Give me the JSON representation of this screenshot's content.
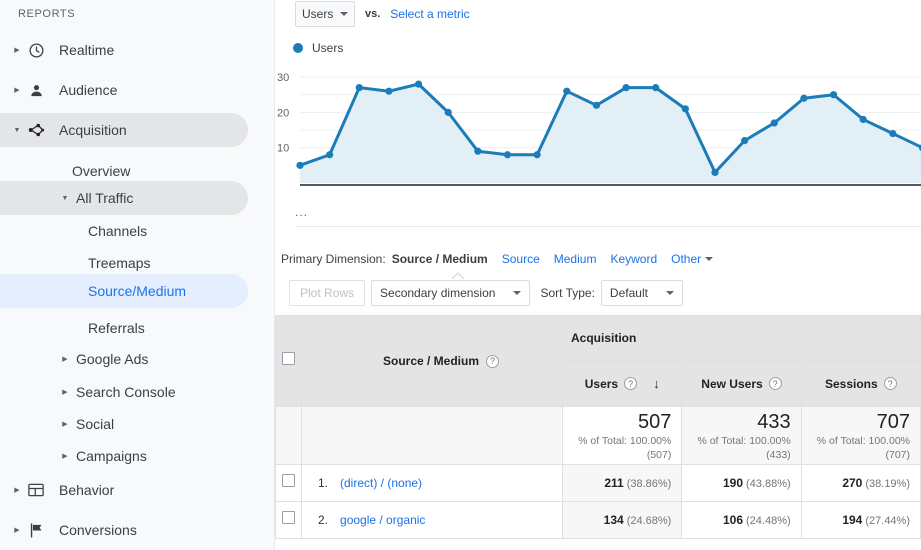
{
  "sidebar": {
    "section_label": "REPORTS",
    "items": [
      {
        "label": "Realtime",
        "icon": "clock-icon",
        "level": 1,
        "expander": "right",
        "selected": "none"
      },
      {
        "label": "Audience",
        "icon": "person-icon",
        "level": 1,
        "expander": "right",
        "selected": "none"
      },
      {
        "label": "Acquisition",
        "icon": "acquisition-icon",
        "level": 1,
        "expander": "down",
        "selected": "grey"
      },
      {
        "label": "Overview",
        "icon": "",
        "level": 2,
        "expander": "none",
        "selected": "none"
      },
      {
        "label": "All Traffic",
        "icon": "",
        "level": 2,
        "expander": "down",
        "selected": "grey"
      },
      {
        "label": "Channels",
        "icon": "",
        "level": 3,
        "expander": "none",
        "selected": "none"
      },
      {
        "label": "Treemaps",
        "icon": "",
        "level": 3,
        "expander": "none",
        "selected": "none"
      },
      {
        "label": "Source/Medium",
        "icon": "",
        "level": 3,
        "expander": "none",
        "selected": "blue"
      },
      {
        "label": "Referrals",
        "icon": "",
        "level": 3,
        "expander": "none",
        "selected": "none"
      },
      {
        "label": "Google Ads",
        "icon": "",
        "level": 2,
        "expander": "right",
        "selected": "none"
      },
      {
        "label": "Search Console",
        "icon": "",
        "level": 2,
        "expander": "right",
        "selected": "none"
      },
      {
        "label": "Social",
        "icon": "",
        "level": 2,
        "expander": "right",
        "selected": "none"
      },
      {
        "label": "Campaigns",
        "icon": "",
        "level": 2,
        "expander": "right",
        "selected": "none"
      },
      {
        "label": "Behavior",
        "icon": "behavior-icon",
        "level": 1,
        "expander": "right",
        "selected": "none"
      },
      {
        "label": "Conversions",
        "icon": "flag-icon",
        "level": 1,
        "expander": "right",
        "selected": "none"
      }
    ]
  },
  "metric_bar": {
    "selected_metric": "Users",
    "vs_label": "vs.",
    "select_metric_link": "Select a metric"
  },
  "legend": {
    "series_label": "Users",
    "color": "#1b7cb8"
  },
  "chart_ellipsis": "...",
  "primary_dimension": {
    "label": "Primary Dimension:",
    "active": "Source / Medium",
    "links": [
      "Source",
      "Medium",
      "Keyword"
    ],
    "other_label": "Other"
  },
  "controls": {
    "plot_rows": "Plot Rows",
    "secondary_dimension": "Secondary dimension",
    "sort_type_label": "Sort Type:",
    "sort_type_value": "Default"
  },
  "table": {
    "group_header": "Acquisition",
    "dimension_header": "Source / Medium",
    "metric_headers": [
      "Users",
      "New Users",
      "Sessions"
    ],
    "sort_arrow": "↓",
    "help_glyph": "?",
    "totals": [
      {
        "value": "507",
        "pct_line": "% of Total: 100.00%",
        "paren": "(507)"
      },
      {
        "value": "433",
        "pct_line": "% of Total: 100.00%",
        "paren": "(433)"
      },
      {
        "value": "707",
        "pct_line": "% of Total: 100.00%",
        "paren": "(707)"
      }
    ],
    "rows": [
      {
        "index": "1.",
        "source": "(direct) / (none)",
        "users": "211",
        "users_pct": "(38.86%)",
        "new_users": "190",
        "new_users_pct": "(43.88%)",
        "sessions": "270",
        "sessions_pct": "(38.19%)"
      },
      {
        "index": "2.",
        "source": "google / organic",
        "users": "134",
        "users_pct": "(24.68%)",
        "new_users": "106",
        "new_users_pct": "(24.48%)",
        "sessions": "194",
        "sessions_pct": "(27.44%)"
      }
    ]
  },
  "chart_data": {
    "type": "area",
    "title": "Users",
    "xlabel": "",
    "ylabel": "Users",
    "ylim": [
      0,
      32
    ],
    "yticks": [
      10,
      20,
      30
    ],
    "grid": true,
    "legend_position": "top-left",
    "line_color": "#1b7cb8",
    "fill_color": "#e3eff7",
    "series": [
      {
        "name": "Users",
        "values": [
          5,
          8,
          27,
          26,
          28,
          20,
          9,
          8,
          8,
          26,
          22,
          27,
          27,
          21,
          3,
          12,
          17,
          24,
          25,
          18,
          14,
          10
        ]
      }
    ]
  }
}
